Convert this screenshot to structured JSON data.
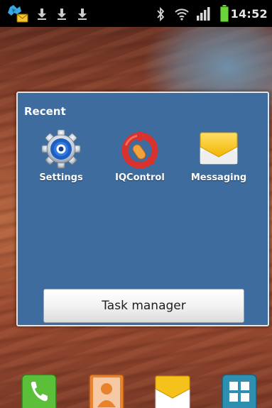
{
  "status_bar": {
    "time": "14:52",
    "left_icons": [
      "weather-update-icon",
      "download-icon",
      "download-icon",
      "download-icon"
    ],
    "right_icons": [
      "bluetooth-icon",
      "wifi-icon",
      "signal-icon",
      "battery-icon"
    ]
  },
  "recent_dialog": {
    "title": "Recent",
    "apps": [
      {
        "label": "Settings",
        "icon": "settings-gear-icon"
      },
      {
        "label": "IQControl",
        "icon": "iqcontrol-icon"
      },
      {
        "label": "Messaging",
        "icon": "messaging-envelope-icon"
      }
    ],
    "task_manager_label": "Task manager"
  },
  "dock": {
    "icons": [
      "phone-icon",
      "contacts-icon",
      "messaging-icon",
      "apps-grid-icon"
    ]
  },
  "colors": {
    "dialog_background": "#3f6c9e",
    "status_bar": "#000000",
    "battery": "#6ad43a"
  }
}
